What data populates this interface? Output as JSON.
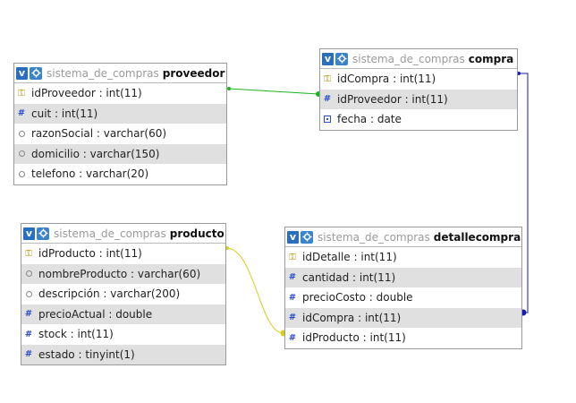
{
  "tables": [
    {
      "id": "proveedor",
      "db": "sistema_de_compras",
      "name": "proveedor",
      "columns": [
        {
          "label": "idProveedor : int(11)",
          "icon": "key-icon"
        },
        {
          "label": "cuit : int(11)",
          "icon": "hash-icon"
        },
        {
          "label": "razonSocial : varchar(60)",
          "icon": "text-icon"
        },
        {
          "label": "domicilio : varchar(150)",
          "icon": "text-icon"
        },
        {
          "label": "telefono : varchar(20)",
          "icon": "text-icon"
        }
      ]
    },
    {
      "id": "compra",
      "db": "sistema_de_compras",
      "name": "compra",
      "columns": [
        {
          "label": "idCompra : int(11)",
          "icon": "key-icon"
        },
        {
          "label": "idProveedor : int(11)",
          "icon": "hash-icon"
        },
        {
          "label": "fecha : date",
          "icon": "calendar-icon"
        }
      ]
    },
    {
      "id": "producto",
      "db": "sistema_de_compras",
      "name": "producto",
      "columns": [
        {
          "label": "idProducto : int(11)",
          "icon": "key-icon"
        },
        {
          "label": "nombreProducto : varchar(60)",
          "icon": "text-icon"
        },
        {
          "label": "descripción : varchar(200)",
          "icon": "text-icon"
        },
        {
          "label": "precioActual : double",
          "icon": "hash-icon"
        },
        {
          "label": "stock : int(11)",
          "icon": "hash-icon"
        },
        {
          "label": "estado : tinyint(1)",
          "icon": "hash-icon"
        }
      ]
    },
    {
      "id": "detallecompra",
      "db": "sistema_de_compras",
      "name": "detallecompra",
      "columns": [
        {
          "label": "idDetalle : int(11)",
          "icon": "key-icon"
        },
        {
          "label": "cantidad : int(11)",
          "icon": "hash-icon"
        },
        {
          "label": "precioCosto : double",
          "icon": "hash-icon"
        },
        {
          "label": "idCompra : int(11)",
          "icon": "hash-icon"
        },
        {
          "label": "idProducto : int(11)",
          "icon": "hash-icon"
        }
      ]
    }
  ],
  "relations": [
    {
      "from": "proveedor.idProveedor",
      "to": "compra.idProveedor",
      "color": "#1db31d"
    },
    {
      "from": "compra.idCompra",
      "to": "detallecompra.idCompra",
      "color": "#1a1ab8"
    },
    {
      "from": "producto.idProducto",
      "to": "detallecompra.idProducto",
      "color": "#d8cc1a"
    }
  ],
  "colors": {
    "header_badge": "#2a6fbe",
    "alt_row": "#e0e0e0"
  }
}
